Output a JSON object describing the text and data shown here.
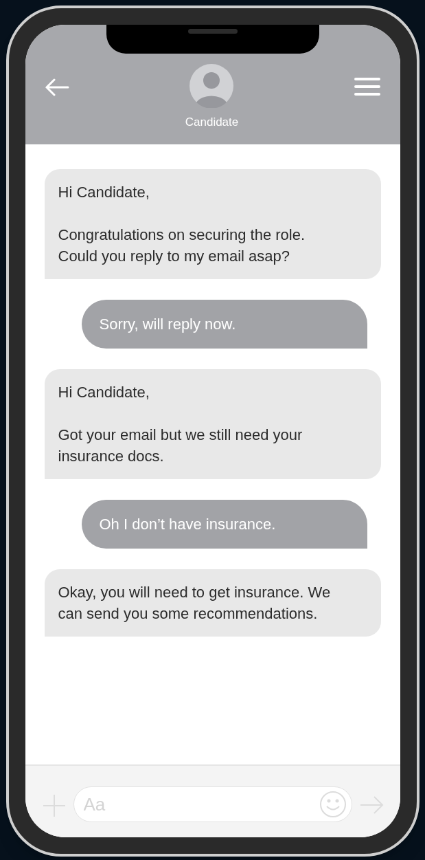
{
  "header": {
    "contact_name": "Candidate"
  },
  "messages": [
    {
      "kind": "received",
      "paragraphs": [
        "Hi Candidate,",
        "Congratulations on securing the role. Could you reply to my email asap?"
      ]
    },
    {
      "kind": "sent",
      "paragraphs": [
        "Sorry, will reply now."
      ]
    },
    {
      "kind": "received",
      "paragraphs": [
        "Hi Candidate,",
        "Got your email but we still need your insurance docs."
      ]
    },
    {
      "kind": "sent",
      "paragraphs": [
        "Oh I don’t have insurance."
      ]
    },
    {
      "kind": "received",
      "paragraphs": [
        "Okay, you will need to get insurance. We can send you some recommendations."
      ]
    }
  ],
  "composer": {
    "placeholder": "Aa"
  }
}
